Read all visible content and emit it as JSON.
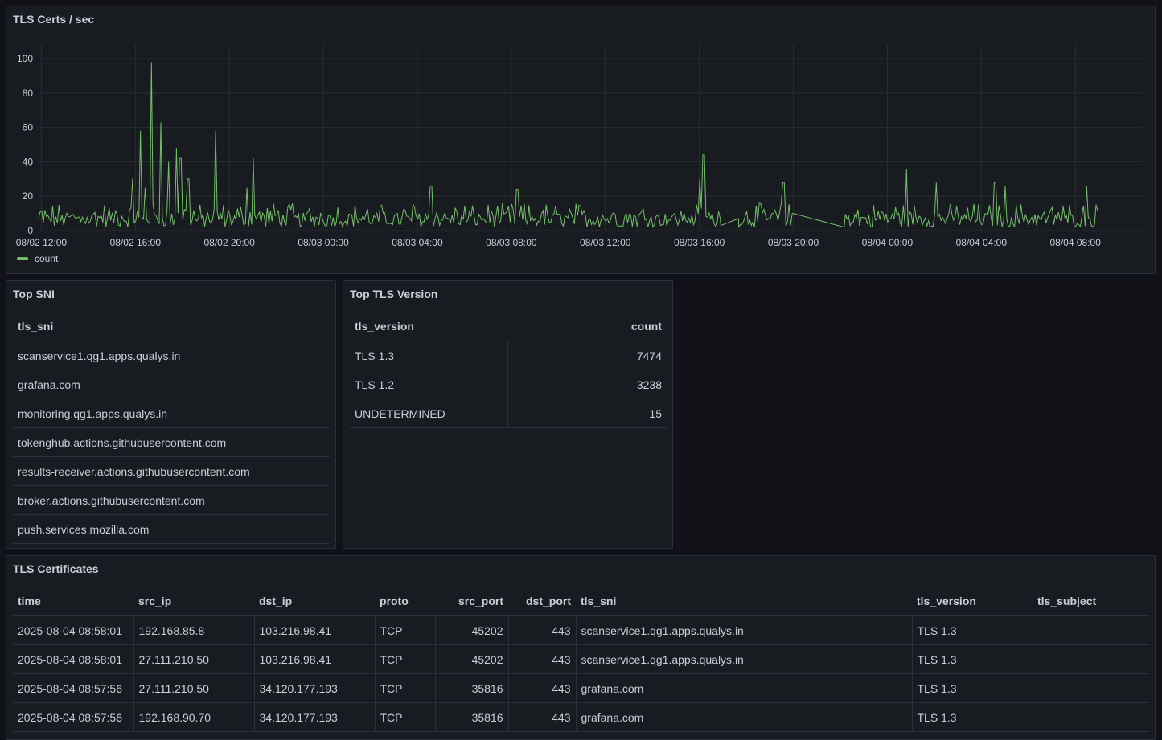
{
  "panels": {
    "chart": {
      "title": "TLS Certs / sec"
    },
    "sni": {
      "title": "Top SNI"
    },
    "version": {
      "title": "Top TLS Version"
    },
    "certs": {
      "title": "TLS Certificates"
    }
  },
  "chart_data": {
    "type": "line",
    "title": "TLS Certs / sec",
    "ylim": [
      0,
      100
    ],
    "y_ticks": [
      "0",
      "20",
      "40",
      "60",
      "80",
      "100"
    ],
    "x_ticks": [
      "08/02 12:00",
      "08/02 16:00",
      "08/02 20:00",
      "08/03 00:00",
      "08/03 04:00",
      "08/03 08:00",
      "08/03 12:00",
      "08/03 16:00",
      "08/03 20:00",
      "08/04 00:00",
      "08/04 04:00",
      "08/04 08:00"
    ],
    "x_range": [
      "08/02 11:53",
      "08/04 10:50"
    ],
    "grid": true,
    "legend": "bottom-left",
    "color": "#73bf69",
    "series": [
      {
        "name": "count",
        "baseline_range": [
          2,
          16
        ],
        "peaks": [
          {
            "time": "08/02 15:53",
            "value": 30
          },
          {
            "time": "08/02 16:12",
            "value": 58
          },
          {
            "time": "08/02 16:24",
            "value": 25
          },
          {
            "time": "08/02 16:40",
            "value": 98
          },
          {
            "time": "08/02 17:05",
            "value": 63
          },
          {
            "time": "08/02 17:25",
            "value": 40
          },
          {
            "time": "08/02 17:45",
            "value": 48
          },
          {
            "time": "08/02 17:55",
            "value": 42
          },
          {
            "time": "08/02 18:15",
            "value": 30
          },
          {
            "time": "08/02 19:25",
            "value": 58
          },
          {
            "time": "08/02 20:45",
            "value": 25
          },
          {
            "time": "08/02 21:00",
            "value": 42
          },
          {
            "time": "08/03 04:35",
            "value": 26
          },
          {
            "time": "08/03 08:15",
            "value": 24
          },
          {
            "time": "08/03 16:00",
            "value": 30
          },
          {
            "time": "08/03 16:11",
            "value": 44
          },
          {
            "time": "08/03 19:35",
            "value": 28
          },
          {
            "time": "08/04 00:50",
            "value": 36
          },
          {
            "time": "08/04 02:05",
            "value": 28
          },
          {
            "time": "08/04 04:35",
            "value": 28
          },
          {
            "time": "08/04 05:00",
            "value": 26
          },
          {
            "time": "08/04 08:30",
            "value": 26
          }
        ],
        "gaps": [
          {
            "from": "08/03 16:55",
            "to": "08/03 17:40",
            "values": [
              3,
              7
            ]
          },
          {
            "from": "08/03 20:00",
            "to": "08/03 22:10",
            "values": [
              10,
              2
            ]
          }
        ],
        "end": "08/04 09:00"
      }
    ]
  },
  "sni": {
    "header": "tls_sni",
    "rows": [
      "scanservice1.qg1.apps.qualys.in",
      "grafana.com",
      "monitoring.qg1.apps.qualys.in",
      "tokenghub.actions.githubusercontent.com",
      "results-receiver.actions.githubusercontent.com",
      "broker.actions.githubusercontent.com",
      "push.services.mozilla.com"
    ]
  },
  "version": {
    "headers": [
      "tls_version",
      "count"
    ],
    "rows": [
      [
        "TLS 1.3",
        "7474"
      ],
      [
        "TLS 1.2",
        "3238"
      ],
      [
        "UNDETERMINED",
        "15"
      ]
    ]
  },
  "certs": {
    "headers": [
      "time",
      "src_ip",
      "dst_ip",
      "proto",
      "src_port",
      "dst_port",
      "tls_sni",
      "tls_version",
      "tls_subject"
    ],
    "rows": [
      [
        "2025-08-04 08:58:01",
        "192.168.85.8",
        "103.216.98.41",
        "TCP",
        "45202",
        "443",
        "scanservice1.qg1.apps.qualys.in",
        "TLS 1.3",
        ""
      ],
      [
        "2025-08-04 08:58:01",
        "27.111.210.50",
        "103.216.98.41",
        "TCP",
        "45202",
        "443",
        "scanservice1.qg1.apps.qualys.in",
        "TLS 1.3",
        ""
      ],
      [
        "2025-08-04 08:57:56",
        "27.111.210.50",
        "34.120.177.193",
        "TCP",
        "35816",
        "443",
        "grafana.com",
        "TLS 1.3",
        ""
      ],
      [
        "2025-08-04 08:57:56",
        "192.168.90.70",
        "34.120.177.193",
        "TCP",
        "35816",
        "443",
        "grafana.com",
        "TLS 1.3",
        ""
      ]
    ]
  }
}
